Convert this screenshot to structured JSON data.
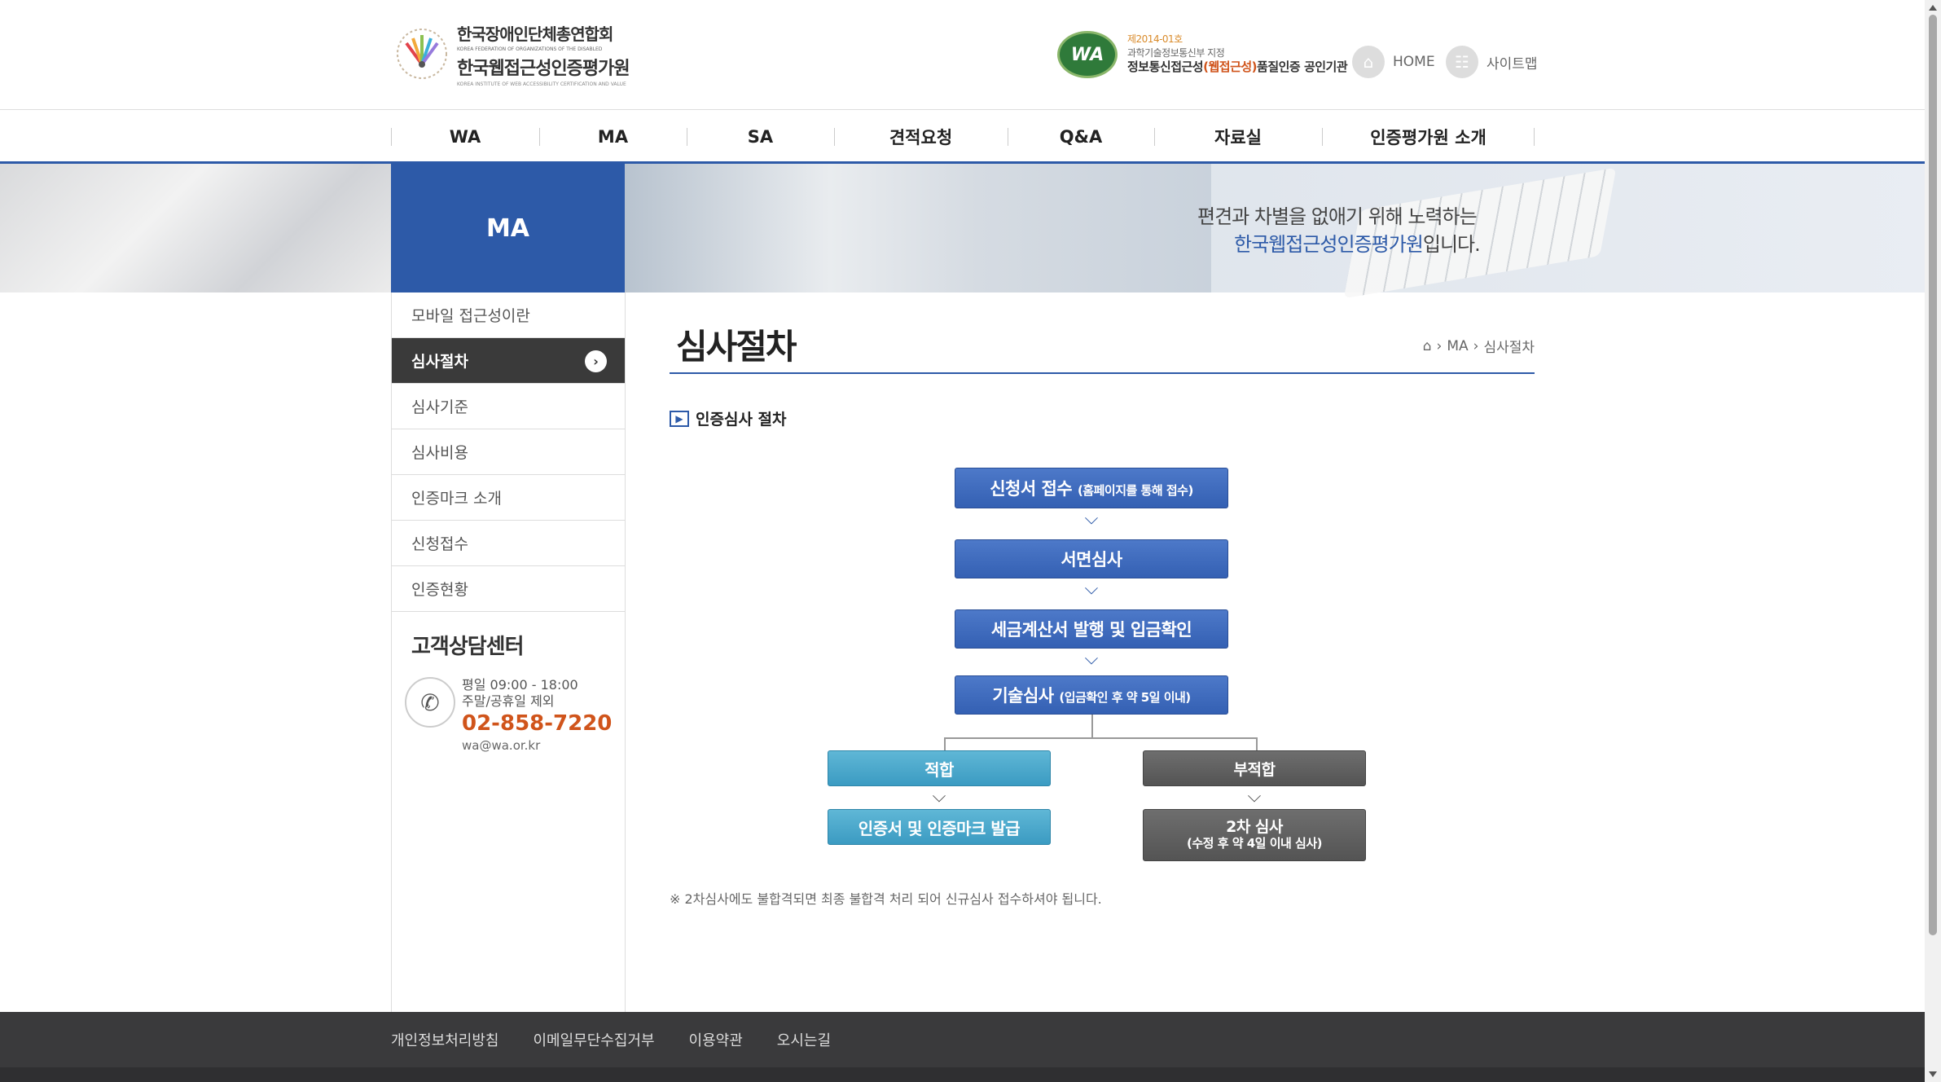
{
  "header": {
    "logo": {
      "line1": "한국장애인단체총연합회",
      "line1_sub": "KOREA FEDERATION OF ORGANIZATIONS OF THE DISABLED",
      "line2": "한국웹접근성인증평가원",
      "line2_sub": "KOREA INSTITUTE OF WEB ACCESSIBILITY CERTIFICATION AND VALUE"
    },
    "cert": {
      "badge": "WA",
      "number": "제2014-01호",
      "agency": "과학기술정보통신부 지정",
      "main_prefix": "정보통신접근성",
      "main_highlight": "(웹접근성)",
      "main_suffix": "품질인증 공인기관"
    },
    "util": {
      "home": "HOME",
      "sitemap": "사이트맵"
    }
  },
  "gnb": [
    "WA",
    "MA",
    "SA",
    "견적요청",
    "Q&A",
    "자료실",
    "인증평가원 소개"
  ],
  "visual": {
    "title": "MA",
    "slogan_line1": "편견과 차별을 없애기 위해 노력하는",
    "slogan_highlight": "한국웹접근성인증평가원",
    "slogan_suffix": "입니다."
  },
  "side": {
    "menu": [
      "모바일 접근성이란",
      "심사절차",
      "심사기준",
      "심사비용",
      "인증마크 소개",
      "신청접수",
      "인증현황"
    ],
    "active_index": 1,
    "cs": {
      "title": "고객상담센터",
      "hours": "평일 09:00 - 18:00",
      "closed": "주말/공휴일 제외",
      "tel": "02-858-7220",
      "email": "wa@wa.or.kr"
    }
  },
  "content": {
    "page_title": "심사절차",
    "breadcrumb": [
      "MA",
      "심사절차"
    ],
    "section_title": "인증심사 절차",
    "flow": {
      "step1": "신청서 접수",
      "step1_note": "(홈페이지를 통해 접수)",
      "step2": "서면심사",
      "step3": "세금계산서 발행 및 입금확인",
      "step4": "기술심사",
      "step4_note": "(입금확인 후 약 5일 이내)",
      "pass": "적합",
      "pass_next": "인증서 및 인증마크 발급",
      "fail": "부적합",
      "fail_next": "2차 심사",
      "fail_next_note": "(수정 후 약 4일 이내 심사)"
    },
    "note": "※ 2차심사에도 불합격되면 최종 불합격 처리 되어 신규심사 접수하셔야 됩니다."
  },
  "footer": [
    "개인정보처리방침",
    "이메일무단수집거부",
    "이용약관",
    "오시는길"
  ],
  "colors": {
    "primary": "#2d5aa8",
    "accent": "#d0541b",
    "pass": "#3b9bc2",
    "fail": "#545454",
    "footer": "#3a3a3c"
  }
}
